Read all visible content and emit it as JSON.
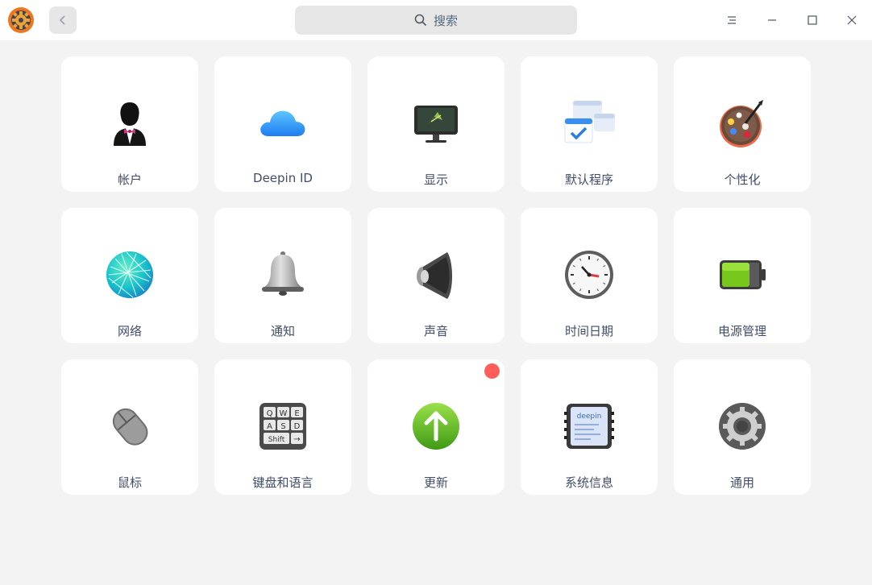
{
  "window": {
    "search_placeholder": "搜索",
    "accent": "#f0761e"
  },
  "modules": [
    {
      "label": "帐户",
      "icon": "account-icon"
    },
    {
      "label": "Deepin ID",
      "icon": "cloud-icon"
    },
    {
      "label": "显示",
      "icon": "monitor-icon"
    },
    {
      "label": "默认程序",
      "icon": "default-apps-icon"
    },
    {
      "label": "个性化",
      "icon": "palette-icon"
    },
    {
      "label": "网络",
      "icon": "globe-icon"
    },
    {
      "label": "通知",
      "icon": "bell-icon"
    },
    {
      "label": "声音",
      "icon": "speaker-icon"
    },
    {
      "label": "时间日期",
      "icon": "clock-icon"
    },
    {
      "label": "电源管理",
      "icon": "battery-icon"
    },
    {
      "label": "鼠标",
      "icon": "mouse-icon"
    },
    {
      "label": "键盘和语言",
      "icon": "keyboard-icon"
    },
    {
      "label": "更新",
      "icon": "update-icon",
      "badge": true
    },
    {
      "label": "系统信息",
      "icon": "system-info-icon"
    },
    {
      "label": "通用",
      "icon": "general-gear-icon"
    }
  ],
  "keyboard_keys": [
    "Q",
    "W",
    "E",
    "A",
    "S",
    "D",
    "Shift",
    "→"
  ],
  "system_info_brand": "deepin"
}
